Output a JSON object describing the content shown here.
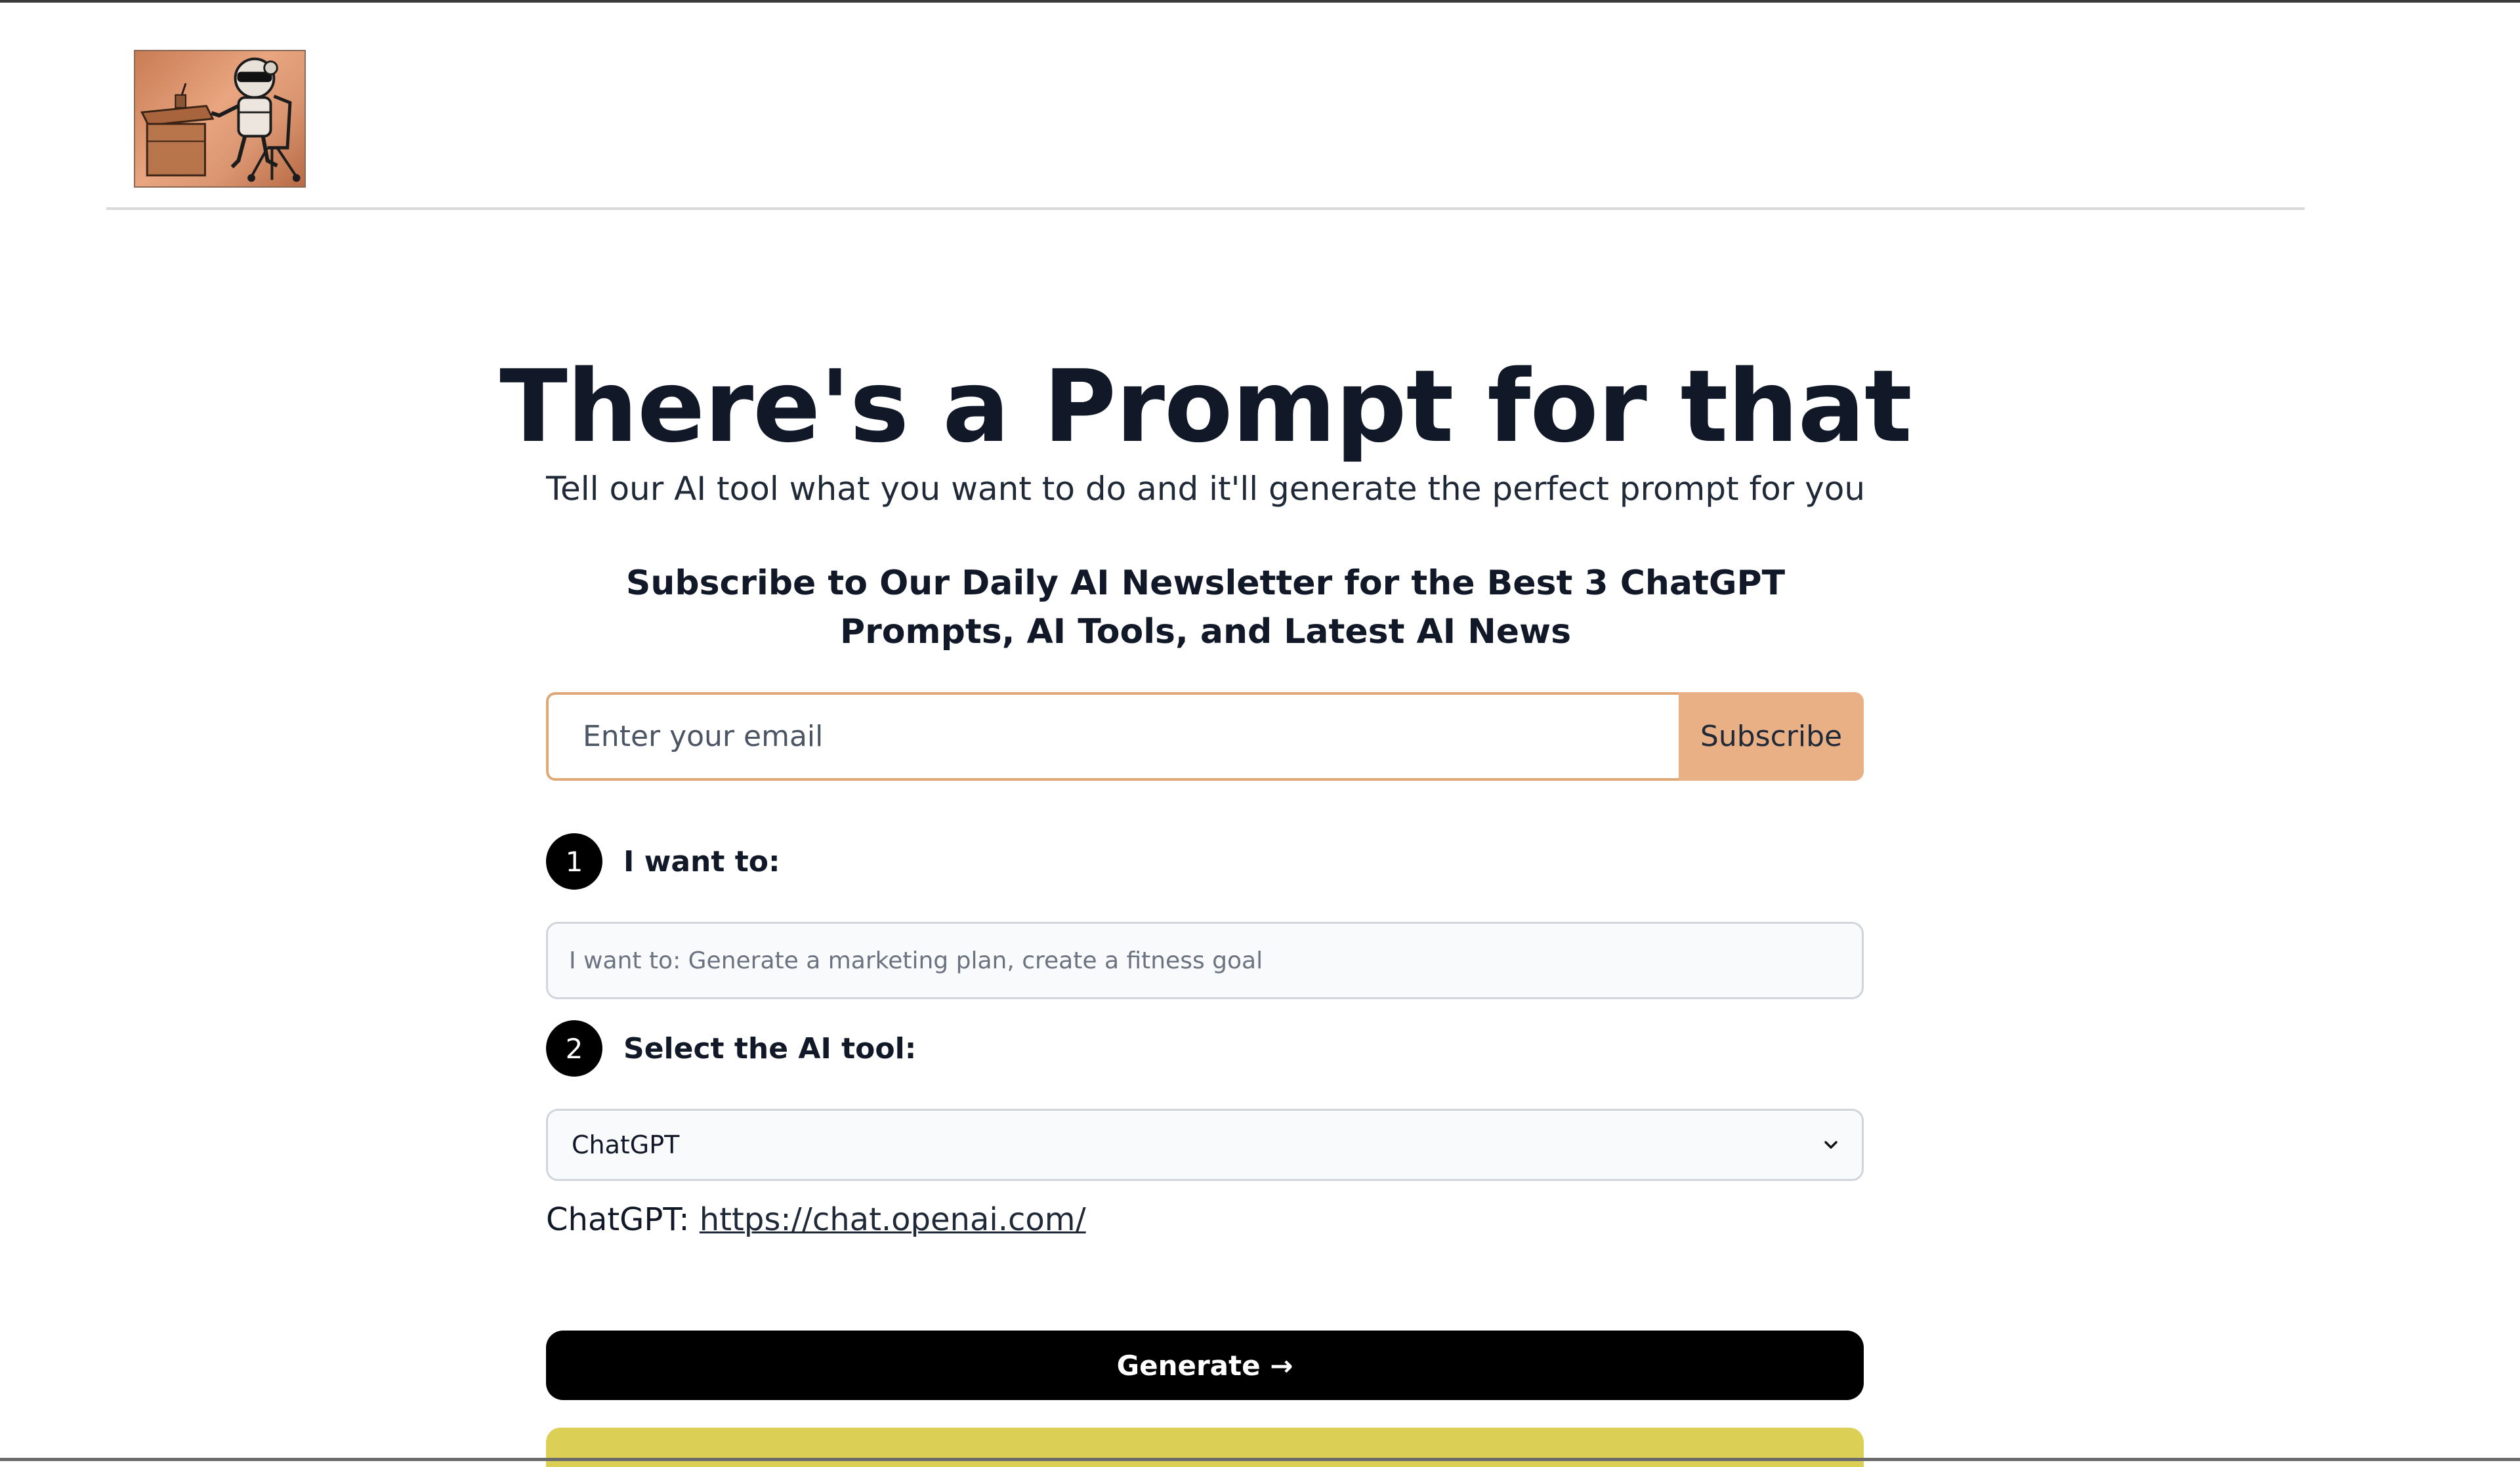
{
  "header": {
    "logo_alt": "robot at desk logo"
  },
  "hero": {
    "title": "There's a Prompt for that",
    "subtitle": "Tell our AI tool what you want to do and it'll generate the perfect prompt for you"
  },
  "newsletter": {
    "title": "Subscribe to Our Daily AI Newsletter for the Best 3 ChatGPT Prompts, AI Tools, and Latest AI News",
    "email_placeholder": "Enter your email",
    "subscribe_label": "Subscribe"
  },
  "step1": {
    "number": "1",
    "label": "I want to:",
    "placeholder": "I want to: Generate a marketing plan, create a fitness goal"
  },
  "step2": {
    "number": "2",
    "label": "Select the AI tool:",
    "selected": "ChatGPT"
  },
  "tool_link": {
    "prefix": "ChatGPT:",
    "url_text": "https://chat.openai.com/"
  },
  "generate": {
    "label": "Generate →"
  },
  "colors": {
    "accent_orange": "#e8b084",
    "input_border_orange": "#e0a877",
    "button_black": "#000000",
    "yellow_bar": "#dccf55"
  },
  "icons": {
    "select_chevron": "chevron-down-icon"
  }
}
